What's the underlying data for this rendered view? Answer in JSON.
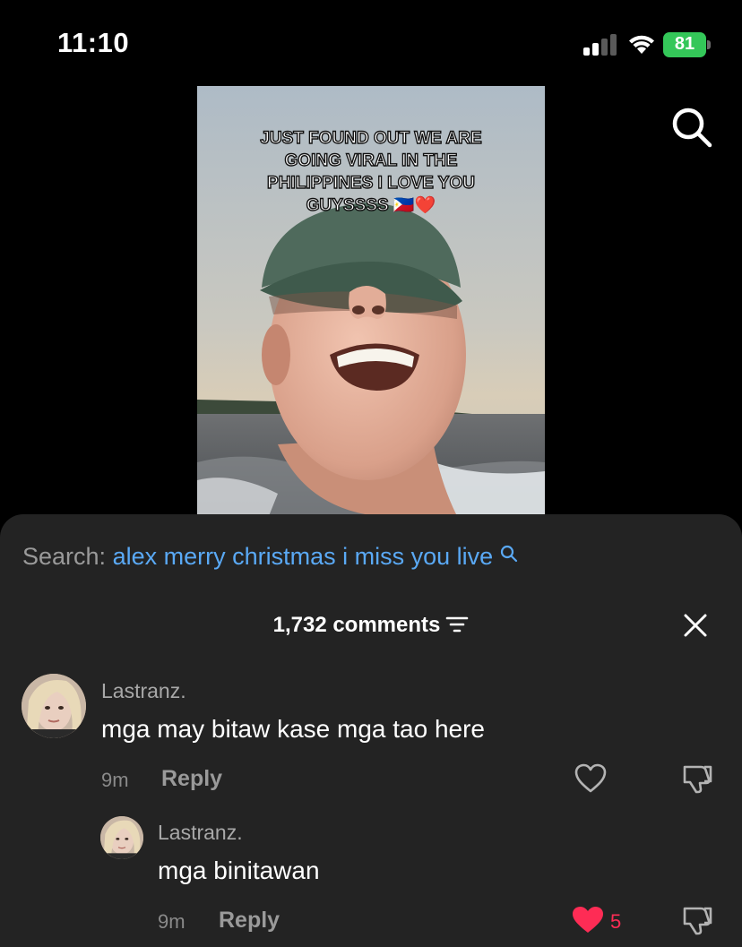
{
  "status_bar": {
    "time": "11:10",
    "battery_percent": "81",
    "battery_color": "#34c759"
  },
  "video": {
    "caption": "JUST FOUND OUT WE ARE GOING VIRAL IN THE PHILIPPINES I LOVE YOU GUYSSSS 🇵🇭❤️"
  },
  "search": {
    "prefix": "Search:",
    "query": "alex merry christmas i miss you live"
  },
  "comments_header": {
    "count_label": "1,732 comments"
  },
  "comments": [
    {
      "username": "Lastranz.",
      "text": "mga may bitaw kase mga tao here",
      "time": "9m",
      "reply_label": "Reply",
      "liked": false
    },
    {
      "username": "Lastranz.",
      "text": "mga binitawan",
      "time": "9m",
      "reply_label": "Reply",
      "liked": true,
      "likes": "5"
    }
  ],
  "colors": {
    "accent_link": "#5aa9f5",
    "like_red": "#fe2c55",
    "sheet_bg": "#232323"
  },
  "icons": [
    "signal-icon",
    "wifi-icon",
    "battery-icon",
    "search-icon",
    "sort-icon",
    "close-icon",
    "heart-icon",
    "dislike-icon"
  ]
}
